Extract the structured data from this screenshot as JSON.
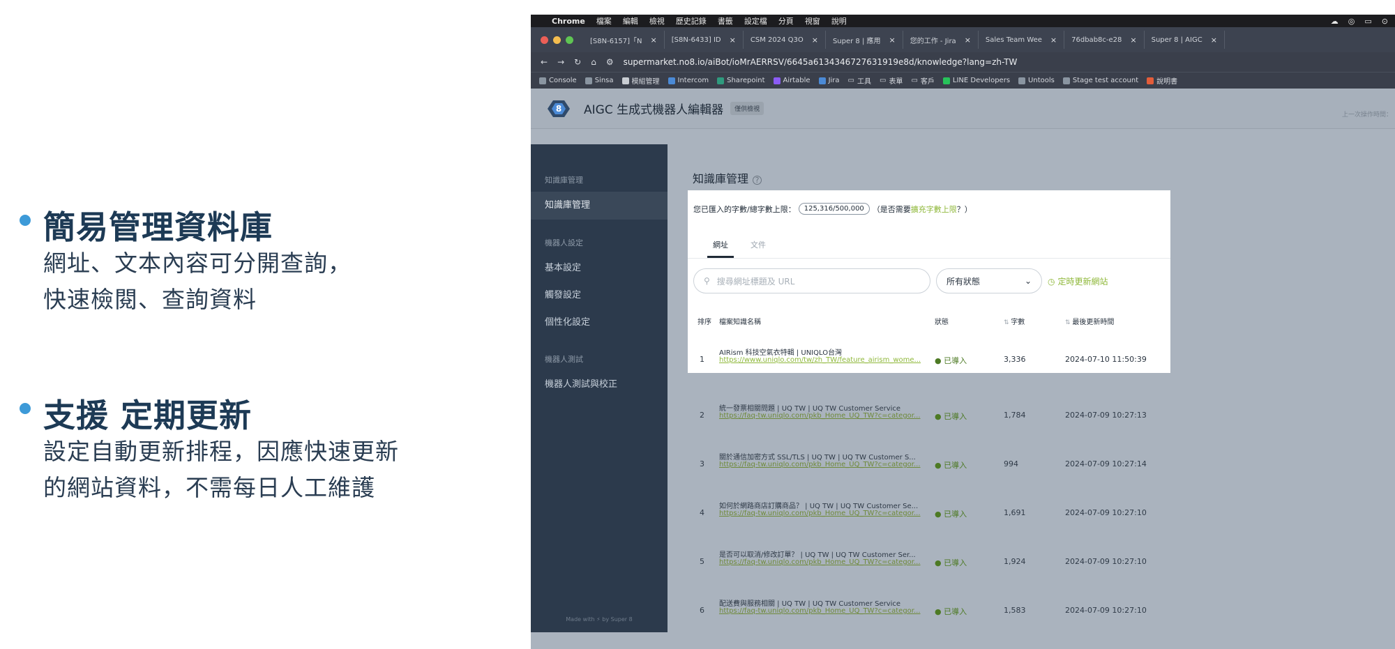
{
  "slide": {
    "bullets": [
      {
        "title": "簡易管理資料庫",
        "lines": [
          "網址、文本內容可分開查詢，",
          "快速檢閱、查詢資料"
        ]
      },
      {
        "title": "支援 定期更新",
        "lines": [
          "設定自動更新排程，因應快速更新",
          "的網站資料，不需每日人工維護"
        ]
      }
    ],
    "accent_color": "#3d9ad8"
  },
  "screenshot": {
    "menubar": {
      "app": "Chrome",
      "items": [
        "檔案",
        "編輯",
        "檢視",
        "歷史記錄",
        "書籤",
        "設定檔",
        "分頁",
        "視窗",
        "說明"
      ]
    },
    "tabs": [
      "[S8N-6157]「N",
      "[S8N-6433] ID",
      "CSM 2024 Q3O",
      "Super 8 | 應用",
      "您的工作 - Jira",
      "Sales Team Wee",
      "76dbab8c-e28",
      "Super 8 | AIGC"
    ],
    "address": "supermarket.no8.io/aiBot/ioMrAERRSV/6645a6134346727631919e8d/knowledge?lang=zh-TW",
    "bookmarks": [
      "Console",
      "Sinsa",
      "模組管理",
      "Intercom",
      "Sharepoint",
      "Airtable",
      "Jira",
      "工具",
      "表單",
      "客戶",
      "LINE Developers",
      "Untools",
      "Stage test account",
      "說明書"
    ],
    "app": {
      "title": "AIGC 生成式機器人編輯器",
      "badge": "僅供檢視",
      "last_op": "上一次操作時間：",
      "sidebar": {
        "groups": [
          {
            "label": "知識庫管理",
            "items": [
              "知識庫管理"
            ]
          },
          {
            "label": "機器人設定",
            "items": [
              "基本設定",
              "觸發設定",
              "個性化設定"
            ]
          },
          {
            "label": "機器人測試",
            "items": [
              "機器人測試與校正"
            ]
          }
        ],
        "footer": "Made with ⚡ by Super 8"
      },
      "page_title": "知識庫管理",
      "quota": {
        "label": "您已匯入的字數/總字數上限：",
        "value": "125,316/500,000",
        "suffix_pre": "（是否需要",
        "link": "擴充字數上限",
        "suffix_post": "？）"
      },
      "content_tabs": [
        "網址",
        "文件"
      ],
      "search_placeholder": "搜尋網址標題及 URL",
      "status_filter": "所有狀態",
      "schedule_link": "定時更新網站",
      "columns": {
        "no": "排序",
        "name": "檔案知識名稱",
        "status": "狀態",
        "count": "字數",
        "updated": "最後更新時間"
      },
      "rows": [
        {
          "no": "1",
          "name": "AIRism 科技空氣衣特輯 | UNIQLO台灣",
          "url": "https://www.uniqlo.com/tw/zh_TW/feature_airism_wome...",
          "status": "已導入",
          "count": "3,336",
          "updated": "2024-07-10 11:50:39"
        },
        {
          "no": "2",
          "name": "統一發票相關問題 | UQ TW | UQ TW Customer Service",
          "url": "https://faq-tw.uniqlo.com/pkb_Home_UQ_TW?c=categor...",
          "status": "已導入",
          "count": "1,784",
          "updated": "2024-07-09 10:27:13"
        },
        {
          "no": "3",
          "name": "關於通信加密方式 SSL/TLS | UQ TW | UQ TW Customer S...",
          "url": "https://faq-tw.uniqlo.com/pkb_Home_UQ_TW?c=categor...",
          "status": "已導入",
          "count": "994",
          "updated": "2024-07-09 10:27:14"
        },
        {
          "no": "4",
          "name": "如何於網路商店訂購商品？ | UQ TW | UQ TW Customer Se...",
          "url": "https://faq-tw.uniqlo.com/pkb_Home_UQ_TW?c=categor...",
          "status": "已導入",
          "count": "1,691",
          "updated": "2024-07-09 10:27:10"
        },
        {
          "no": "5",
          "name": "是否可以取消/修改訂單？ | UQ TW | UQ TW Customer Ser...",
          "url": "https://faq-tw.uniqlo.com/pkb_Home_UQ_TW?c=categor...",
          "status": "已導入",
          "count": "1,924",
          "updated": "2024-07-09 10:27:10"
        },
        {
          "no": "6",
          "name": "配送費與服務相關 | UQ TW | UQ TW Customer Service",
          "url": "https://faq-tw.uniqlo.com/pkb_Home_UQ_TW?c=categor...",
          "status": "已導入",
          "count": "1,583",
          "updated": "2024-07-09 10:27:10"
        }
      ]
    }
  }
}
